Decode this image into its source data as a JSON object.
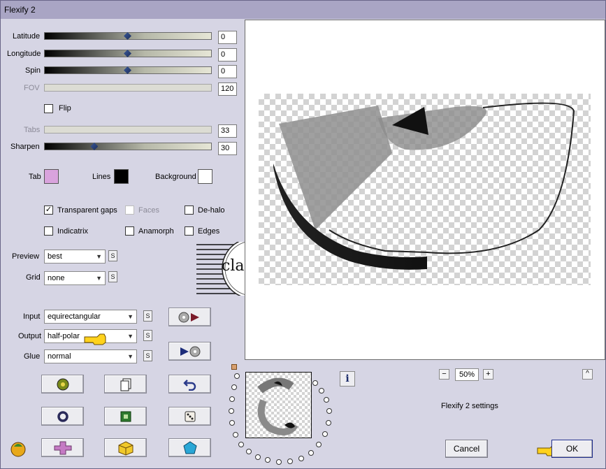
{
  "window": {
    "title": "Flexify 2"
  },
  "params": {
    "latitude": {
      "label": "Latitude",
      "value": "0",
      "level": 0.5
    },
    "longitude": {
      "label": "Longitude",
      "value": "0",
      "level": 0.5
    },
    "spin": {
      "label": "Spin",
      "value": "0",
      "level": 0.5
    },
    "fov": {
      "label": "FOV",
      "value": "120"
    },
    "flip": {
      "label": "Flip",
      "checked": false
    },
    "tabs": {
      "label": "Tabs",
      "value": "33"
    },
    "sharpen": {
      "label": "Sharpen",
      "value": "30",
      "level": 0.3
    }
  },
  "colors": {
    "tab": {
      "label": "Tab",
      "color": "#d9a3dd"
    },
    "lines": {
      "label": "Lines",
      "color": "#000000"
    },
    "background": {
      "label": "Background",
      "color": "#ffffff"
    }
  },
  "options": {
    "transparent_gaps": {
      "label": "Transparent gaps",
      "checked": true
    },
    "faces": {
      "label": "Faces",
      "checked": false
    },
    "de_halo": {
      "label": "De-halo",
      "checked": false
    },
    "indicatrix": {
      "label": "Indicatrix",
      "checked": false
    },
    "anamorph": {
      "label": "Anamorph",
      "checked": false
    },
    "edges": {
      "label": "Edges",
      "checked": false
    }
  },
  "selects": {
    "preview": {
      "label": "Preview",
      "value": "best"
    },
    "grid": {
      "label": "Grid",
      "value": "none"
    },
    "input": {
      "label": "Input",
      "value": "equirectangular"
    },
    "output": {
      "label": "Output",
      "value": "half-polar"
    },
    "glue": {
      "label": "Glue",
      "value": "normal"
    }
  },
  "s_label": "S",
  "watermark": {
    "text": "claudia"
  },
  "zoom": {
    "minus": "−",
    "value": "50%",
    "plus": "+"
  },
  "collapse_symbol": "^",
  "info_symbol": "i",
  "settings_label": "Flexify 2 settings",
  "buttons": {
    "cancel": "Cancel",
    "ok": "OK"
  }
}
